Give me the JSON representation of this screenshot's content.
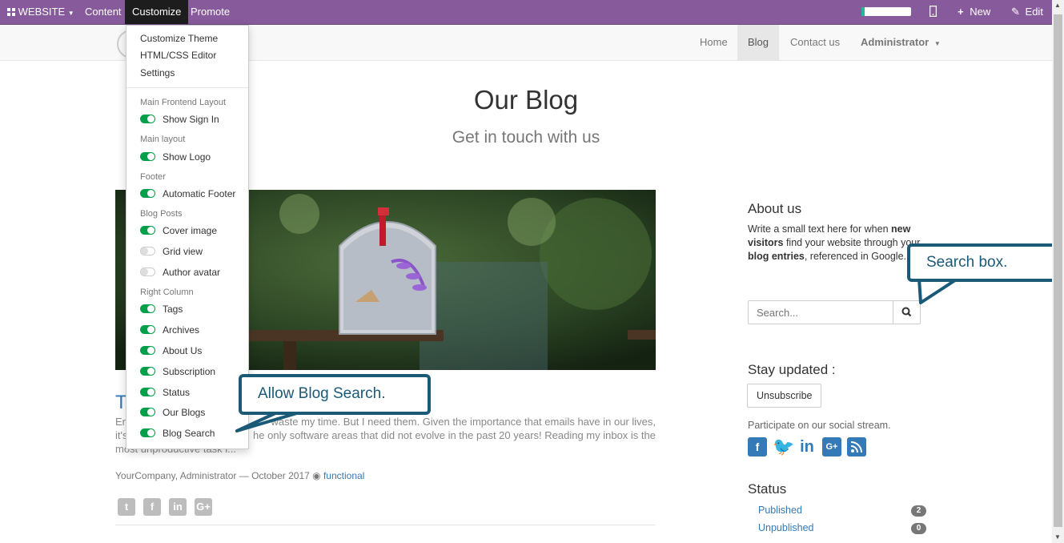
{
  "topbar": {
    "website_label": "WEBSITE",
    "content_label": "Content",
    "customize_label": "Customize",
    "promote_label": "Promote",
    "new_label": "New",
    "edit_label": "Edit",
    "progress": 0.06
  },
  "navbar": {
    "items": [
      "Home",
      "Blog",
      "Contact us"
    ],
    "active": "Blog",
    "user": "Administrator"
  },
  "page": {
    "title": "Our Blog",
    "subtitle": "Get in touch with us"
  },
  "post": {
    "title_visible": "T",
    "excerpt_line1_start": "En",
    "excerpt_line1_end": "waste my time. But I need them. Given the importance that emails have in our lives,",
    "excerpt_line2_start": "it's",
    "excerpt_line2_end": "he only software areas that did not evolve in the past 20 years! Reading my inbox is the",
    "excerpt_line3": "most unproductive task i...",
    "meta": "YourCompany, Administrator — October 2017",
    "tag": "functional"
  },
  "sidebar": {
    "about_title": "About us",
    "about_text_1": "Write a small text here for when ",
    "about_bold_1": "new visitors",
    "about_text_2": " find your website through your ",
    "about_bold_2": "blog entries",
    "about_text_3": ", referenced in Google.",
    "search_placeholder": "Search...",
    "stay_title": "Stay updated :",
    "unsubscribe_label": "Unsubscribe",
    "participate_text": "Participate on our social stream.",
    "status_title": "Status",
    "status_items": [
      {
        "label": "Published",
        "count": "2"
      },
      {
        "label": "Unpublished",
        "count": "0"
      }
    ]
  },
  "dropdown": {
    "items": [
      "Customize Theme",
      "HTML/CSS Editor",
      "Settings"
    ],
    "headers": {
      "main_frontend": "Main Frontend Layout",
      "main_layout": "Main layout",
      "footer": "Footer",
      "blog_posts": "Blog Posts",
      "right_column": "Right Column"
    },
    "toggles": {
      "show_sign_in": {
        "label": "Show Sign In",
        "on": true
      },
      "show_logo": {
        "label": "Show Logo",
        "on": true
      },
      "automatic_footer": {
        "label": "Automatic Footer",
        "on": true
      },
      "cover_image": {
        "label": "Cover image",
        "on": true
      },
      "grid_view": {
        "label": "Grid view",
        "on": false
      },
      "author_avatar": {
        "label": "Author avatar",
        "on": false
      },
      "tags": {
        "label": "Tags",
        "on": true
      },
      "archives": {
        "label": "Archives",
        "on": true
      },
      "about_us": {
        "label": "About Us",
        "on": true
      },
      "subscription": {
        "label": "Subscription",
        "on": true
      },
      "status": {
        "label": "Status",
        "on": true
      },
      "our_blogs": {
        "label": "Our Blogs",
        "on": true
      },
      "blog_search": {
        "label": "Blog Search",
        "on": true
      }
    }
  },
  "callouts": {
    "search_box": "Search box.",
    "allow_search": "Allow Blog Search."
  },
  "colors": {
    "topbar": "#875a9b",
    "toggle_on": "#00a04a",
    "link": "#337ab7",
    "callout": "#1a5a77"
  }
}
